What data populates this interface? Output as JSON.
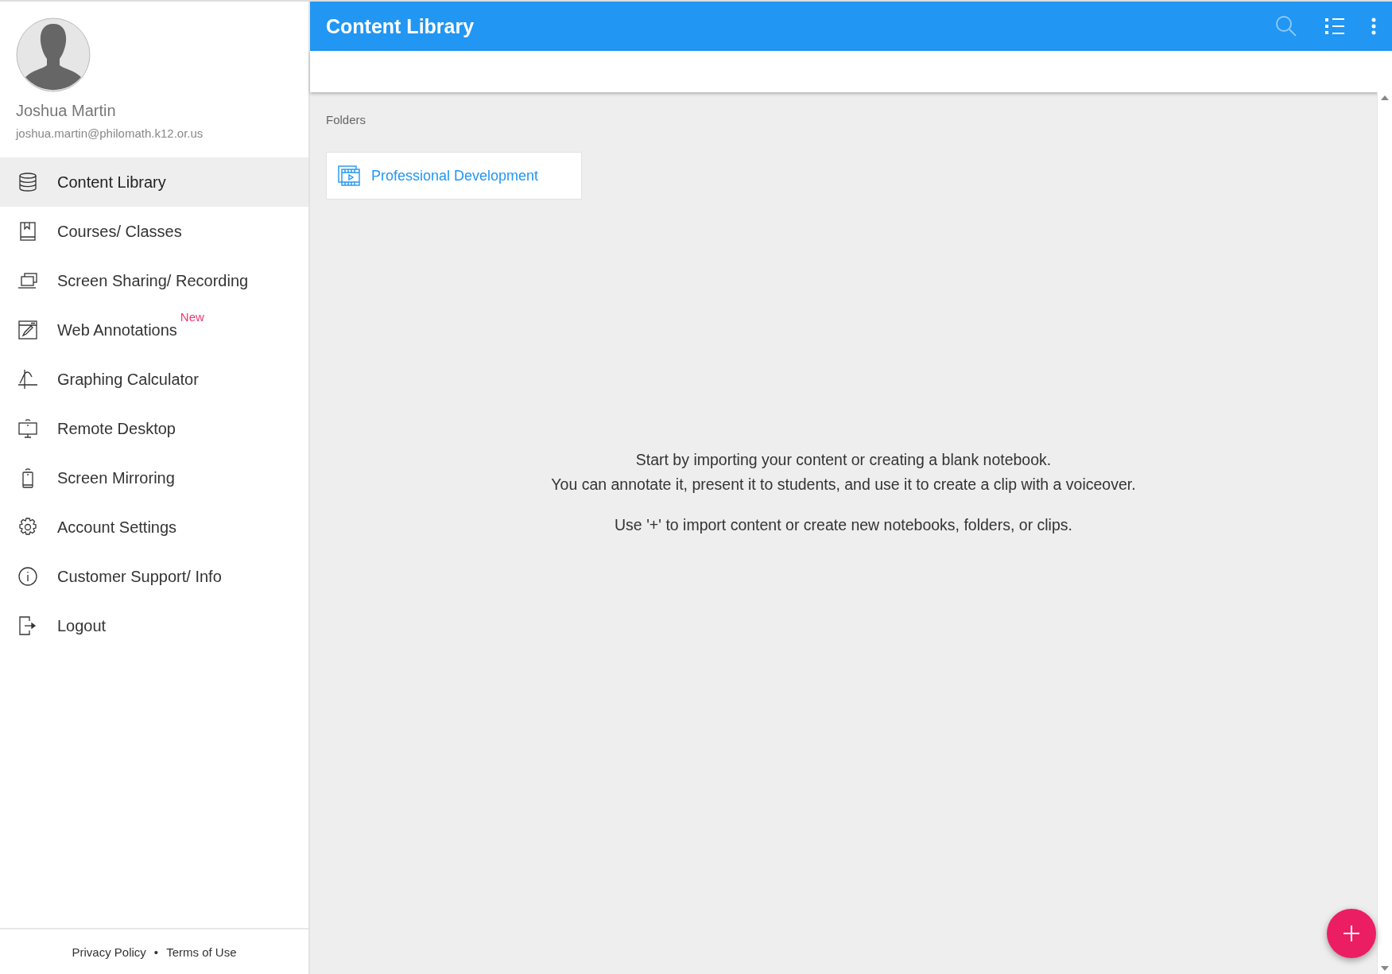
{
  "profile": {
    "name": "Joshua Martin",
    "email": "joshua.martin@philomath.k12.or.us"
  },
  "nav": [
    {
      "label": "Content Library",
      "selected": true
    },
    {
      "label": "Courses/ Classes",
      "selected": false
    },
    {
      "label": "Screen Sharing/ Recording",
      "selected": false
    },
    {
      "label": "Web Annotations",
      "selected": false,
      "badge": "New"
    },
    {
      "label": "Graphing Calculator",
      "selected": false
    },
    {
      "label": "Remote Desktop",
      "selected": false
    },
    {
      "label": "Screen Mirroring",
      "selected": false
    },
    {
      "label": "Account Settings",
      "selected": false
    },
    {
      "label": "Customer Support/ Info",
      "selected": false
    },
    {
      "label": "Logout",
      "selected": false
    }
  ],
  "footer": {
    "links": [
      "Privacy Policy",
      "Terms of Use"
    ],
    "separator": "•"
  },
  "toolbar": {
    "title": "Content Library"
  },
  "folders": {
    "heading": "Folders",
    "items": [
      {
        "name": "Professional Development"
      }
    ]
  },
  "empty_state": {
    "lines": [
      "Start by importing your content or creating a blank notebook.",
      "You can annotate it, present it to students, and use it to create a clip with a voiceover."
    ],
    "hint": "Use '+' to import content or create new notebooks, folders, or clips."
  }
}
